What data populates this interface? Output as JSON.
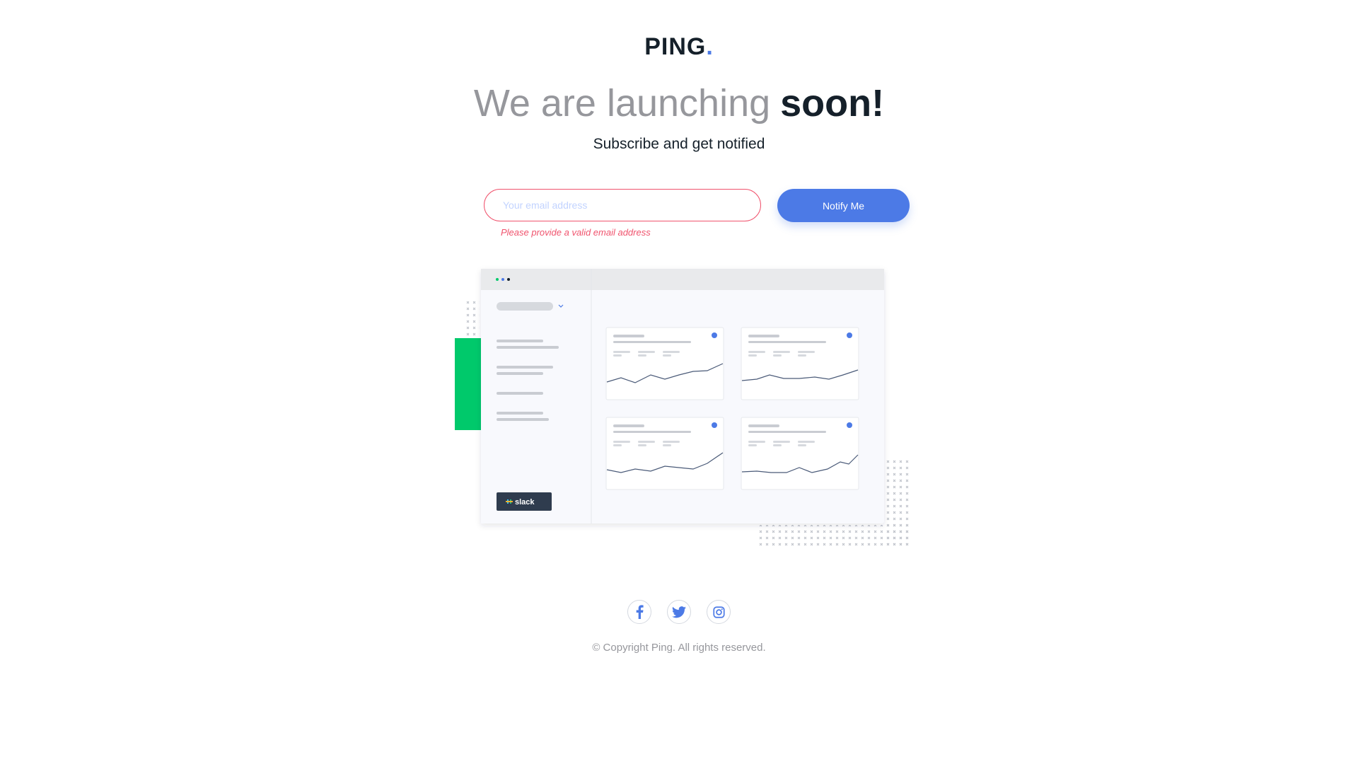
{
  "brand": {
    "name": "PING",
    "dot": "."
  },
  "hero": {
    "headline_light": "We are launching",
    "headline_bold": "soon!",
    "subtitle": "Subscribe and get notified"
  },
  "form": {
    "email_placeholder": "Your email address",
    "email_value": "",
    "error": "Please provide a valid email address",
    "submit_label": "Notify Me"
  },
  "illustration": {
    "slack_label": "slack"
  },
  "footer": {
    "social": [
      {
        "icon": "facebook-icon"
      },
      {
        "icon": "twitter-icon"
      },
      {
        "icon": "instagram-icon"
      }
    ],
    "copyright": "© Copyright Ping. All rights reserved."
  },
  "colors": {
    "primary": "#4c7ae6",
    "error": "#f0536d",
    "dark": "#15202a",
    "gray": "#96979c",
    "green": "#00c96b"
  }
}
